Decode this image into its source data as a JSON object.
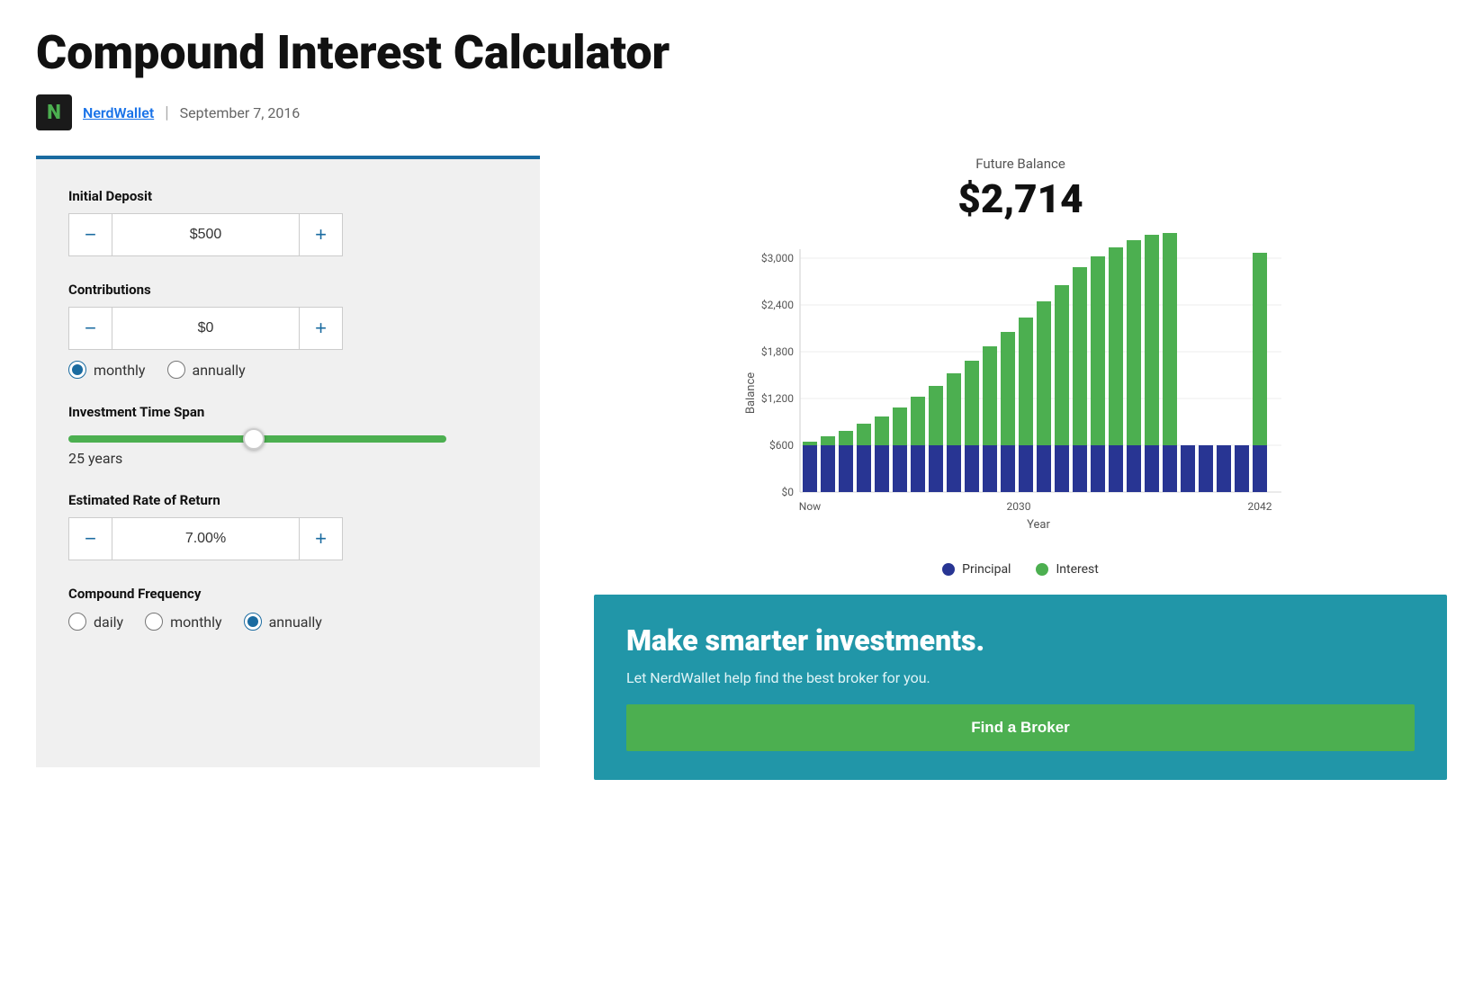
{
  "page": {
    "title": "Compound Interest Calculator",
    "byline": {
      "author": "NerdWallet",
      "date": "September 7, 2016",
      "logo": "N"
    }
  },
  "calculator": {
    "initial_deposit": {
      "label": "Initial Deposit",
      "value": "$500",
      "minus": "−",
      "plus": "+"
    },
    "contributions": {
      "label": "Contributions",
      "value": "$0",
      "minus": "−",
      "plus": "+",
      "frequency_monthly": "monthly",
      "frequency_annually": "annually"
    },
    "time_span": {
      "label": "Investment Time Span",
      "value": 25,
      "unit": "years",
      "min": 1,
      "max": 50,
      "display": "25 years"
    },
    "rate_of_return": {
      "label": "Estimated Rate of Return",
      "value": "7.00%",
      "minus": "−",
      "plus": "+"
    },
    "compound_frequency": {
      "label": "Compound Frequency",
      "daily": "daily",
      "monthly": "monthly",
      "annually": "annually"
    }
  },
  "chart": {
    "title": "Future Balance",
    "amount": "$2,714",
    "y_labels": [
      "$3,000",
      "$2,400",
      "$1,800",
      "$1,200",
      "$600",
      "$0"
    ],
    "x_labels": [
      "Now",
      "2030",
      "2042"
    ],
    "x_axis_label": "Year",
    "y_axis_label": "Balance",
    "legend": {
      "principal_label": "Principal",
      "interest_label": "Interest",
      "principal_color": "#283593",
      "interest_color": "#4caf50"
    }
  },
  "promo": {
    "title": "Make smarter investments.",
    "subtitle": "Let NerdWallet help find the best broker for you.",
    "button_label": "Find a Broker"
  }
}
